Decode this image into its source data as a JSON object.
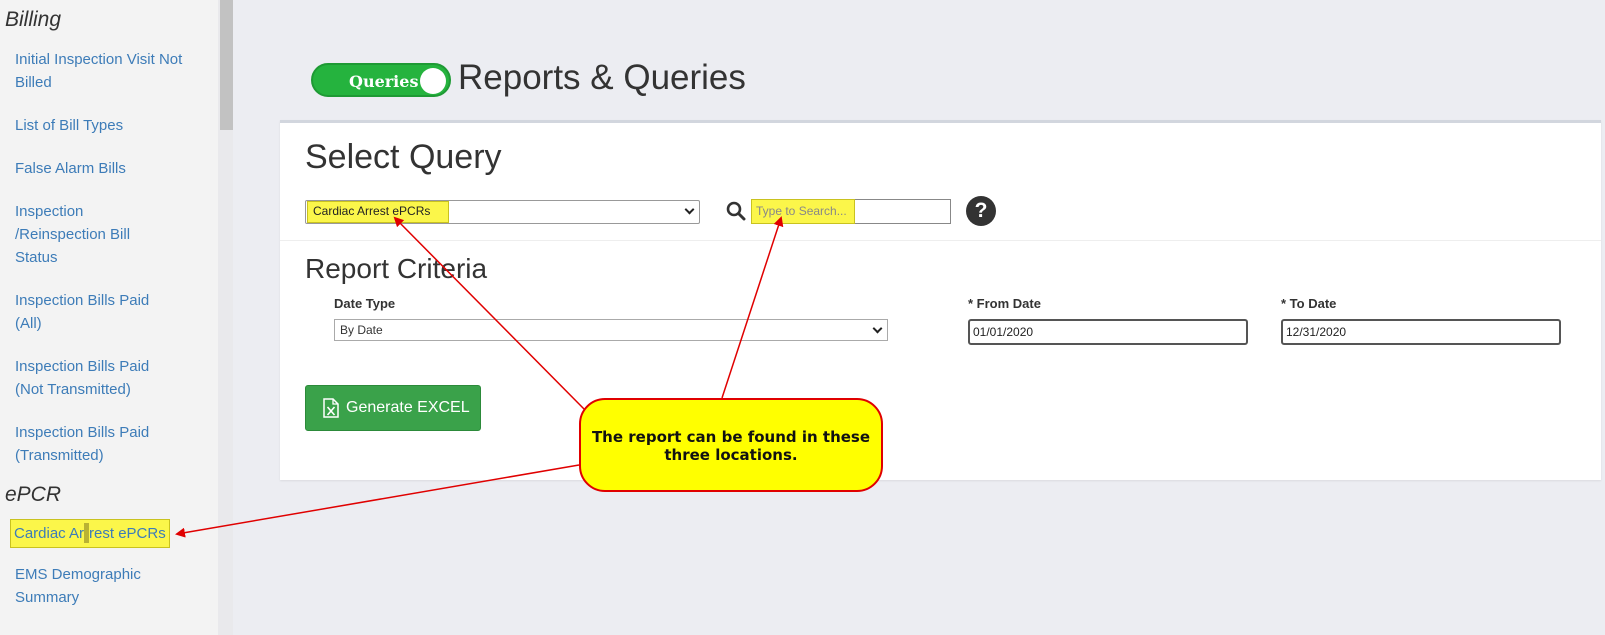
{
  "sidebar": {
    "section_billing": "Billing",
    "items": [
      {
        "label": "Initial Inspection Visit Not Billed"
      },
      {
        "label": "List of Bill Types"
      },
      {
        "label": "False Alarm Bills"
      },
      {
        "label": "Inspection /Reinspection Bill Status"
      },
      {
        "label": "Inspection Bills Paid (All)"
      },
      {
        "label": "Inspection Bills Paid (Not Transmitted)"
      },
      {
        "label": "Inspection Bills Paid (Transmitted)"
      }
    ],
    "section_epcr": "ePCR",
    "epcr_items": [
      {
        "label_a": "Cardiac Ar",
        "label_b": "rest ePCRs"
      },
      {
        "label": "EMS Demographic Summary"
      }
    ]
  },
  "header": {
    "toggle_label": "Queries",
    "title": "Reports & Queries"
  },
  "select_query": {
    "title": "Select Query",
    "selected": "Cardiac Arrest ePCRs",
    "search_placeholder": "Type to Search...",
    "help": "?"
  },
  "report_criteria": {
    "title": "Report Criteria",
    "date_type_label": "Date Type",
    "date_type_value": "By Date",
    "from_label": "* From Date",
    "from_value": "01/01/2020",
    "to_label": "* To Date",
    "to_value": "12/31/2020"
  },
  "actions": {
    "generate_label": "Generate EXCEL"
  },
  "annotation": {
    "line1": "The report can be found in these",
    "line2": "three locations."
  },
  "colors": {
    "highlight": "#fbf64a",
    "toggle_green": "#25b33e",
    "button_green": "#3aa24a",
    "arrow_red": "#e00000",
    "link_blue": "#3d7cb8"
  }
}
